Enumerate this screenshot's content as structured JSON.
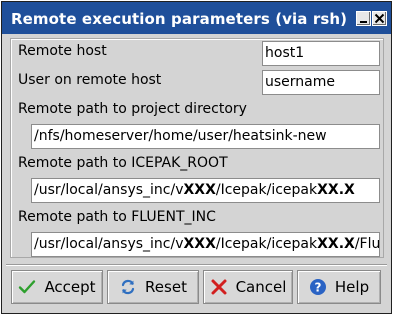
{
  "window": {
    "title": "Remote execution parameters (via rsh)"
  },
  "title_buttons": {
    "minimize_icon": "minimize-icon",
    "close_icon": "close-icon"
  },
  "form": {
    "remote_host_label": "Remote host",
    "remote_host_value": "host1",
    "user_label": "User on remote host",
    "user_value": "username",
    "project_dir_label": "Remote path to project directory",
    "project_dir_value": "/nfs/homeserver/home/user/heatsink-new",
    "icepak_root_label": "Remote path to ICEPAK_ROOT",
    "icepak_root_value_parts": [
      "/usr/local/ansys_inc/v",
      "XXX",
      "/Icepak/icepak",
      "XX.X"
    ],
    "fluent_inc_label": "Remote path to FLUENT_INC",
    "fluent_inc_value_parts": [
      "/usr/local/ansys_inc/v",
      "XXX",
      "/Icepak/icepak",
      "XX.X",
      "/Fluent"
    ]
  },
  "buttons": {
    "accept_label": "Accept",
    "reset_label": "Reset",
    "cancel_label": "Cancel",
    "help_label": "Help"
  },
  "colors": {
    "titlebar": "#1f4f9a",
    "accept_icon": "#2ea02e",
    "reset_icon": "#2f6fc0",
    "cancel_icon": "#d21f1f",
    "help_icon": "#2a63c4"
  }
}
